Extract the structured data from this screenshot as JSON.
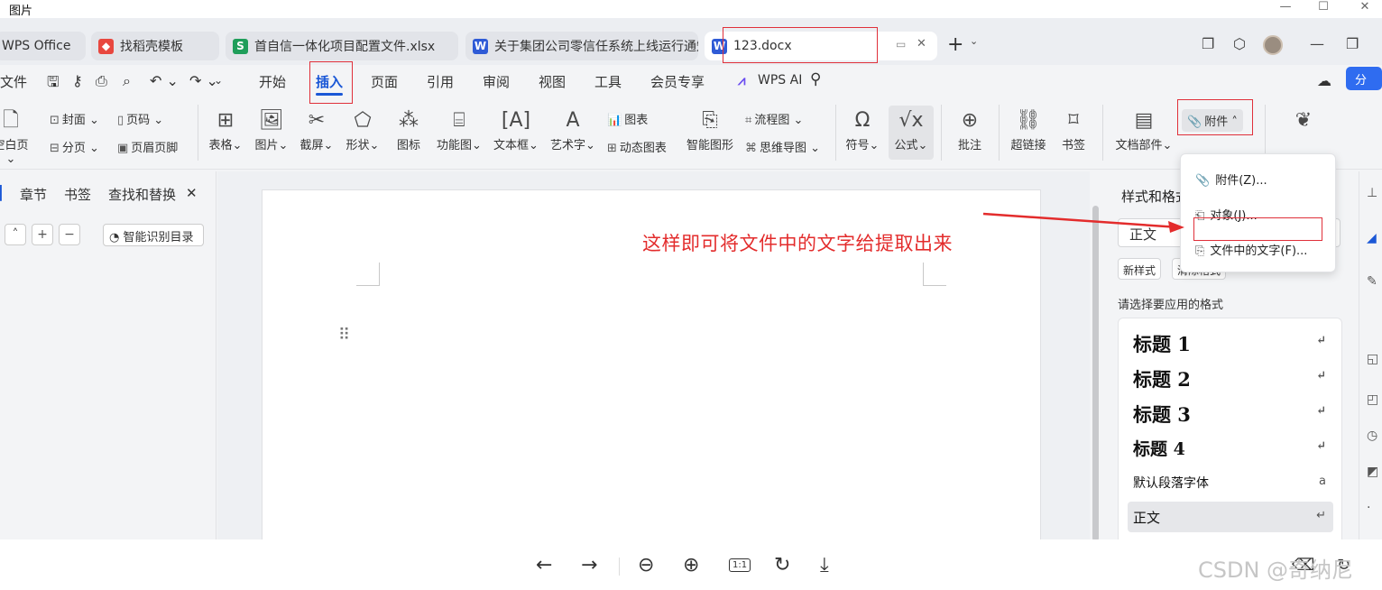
{
  "viewer": {
    "title": "图片"
  },
  "tabs": [
    {
      "label": "WPS Office",
      "icon": "wps-logo-icon"
    },
    {
      "label": "找稻壳模板",
      "icon": "docer-icon",
      "icon_color": "#e8473f"
    },
    {
      "label": "首自信一体化项目配置文件.xlsx",
      "icon": "S",
      "icon_color": "#1f9e5a"
    },
    {
      "label": "关于集团公司零信任系统上线运行通知",
      "icon": "W",
      "icon_color": "#2f5bd6"
    },
    {
      "label": "123.docx",
      "icon": "W",
      "icon_color": "#2f5bd6"
    }
  ],
  "menu": {
    "file": "文件",
    "items": [
      "开始",
      "插入",
      "页面",
      "引用",
      "审阅",
      "视图",
      "工具",
      "会员专享"
    ],
    "active": "插入",
    "wps_ai": "WPS AI",
    "share": "分"
  },
  "ribbon": {
    "cover": "封面",
    "blank_page": "空白页",
    "page_number": "页码",
    "page_break": "分页",
    "header_footer": "页眉页脚",
    "table": "表格",
    "picture": "图片",
    "screenshot": "截屏",
    "shape": "形状",
    "icon": "图标",
    "function_chart": "功能图",
    "textbox": "文本框",
    "wordart": "艺术字",
    "chart": "图表",
    "dynamic_chart": "动态图表",
    "smart_graphic": "智能图形",
    "flowchart": "流程图",
    "mindmap": "思维导图",
    "symbol": "符号",
    "formula": "公式",
    "comment": "批注",
    "hyperlink": "超链接",
    "bookmark": "书签",
    "doc_parts": "文档部件",
    "attachment": "附件"
  },
  "attachment_menu": [
    "附件(Z)...",
    "对象(J)...",
    "文件中的文字(F)..."
  ],
  "left_panel": {
    "tabs": [
      "章节",
      "书签",
      "查找和替换"
    ],
    "smart_toc": "智能识别目录"
  },
  "annotation": "这样即可将文件中的文字给提取出来",
  "style_panel": {
    "title": "样式和格式",
    "current_style": "正文",
    "new_style": "新样式",
    "clear_format": "清除格式",
    "hint": "请选择要应用的格式",
    "styles": [
      {
        "name": "标题  1",
        "mark": "↵"
      },
      {
        "name": "标题  2",
        "mark": "↵"
      },
      {
        "name": "标题  3",
        "mark": "↵"
      },
      {
        "name": "标题  4",
        "mark": "↵"
      },
      {
        "name": "默认段落字体",
        "mark": "a"
      },
      {
        "name": "正文",
        "mark": "↵"
      }
    ]
  },
  "watermark": "CSDN @奇纳尼",
  "accent_color": "#1a57d6",
  "highlight_color": "#e0303a"
}
